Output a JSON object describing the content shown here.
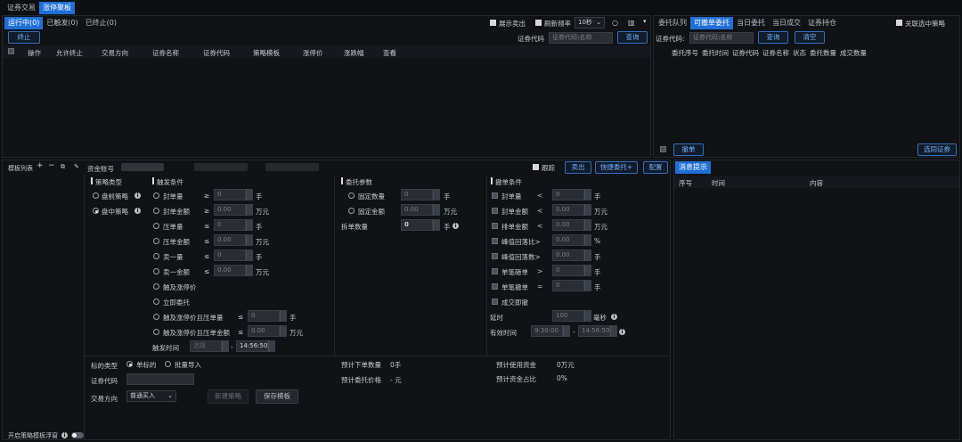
{
  "top_tabs": [
    "证券交易",
    "涨停聚板"
  ],
  "strategy_panel": {
    "status_tabs": [
      "运行中(0)",
      "已触发(0)",
      "已终止(0)"
    ],
    "show_sell": "展示卖出",
    "refresh_rate_label": "刷新频率",
    "refresh_rate_value": "10秒",
    "stop_button": "终止",
    "code_label": "证券代码",
    "code_placeholder": "证券代码\\名称",
    "query_button": "查询",
    "columns": [
      "操作",
      "允许终止",
      "交易方向",
      "证券名称",
      "证券代码",
      "策略模板",
      "涨停价",
      "涨跌幅",
      "查看"
    ]
  },
  "order_panel": {
    "tabs": [
      "委托队列",
      "可撤单委托",
      "当日委托",
      "当日成交",
      "证券持仓"
    ],
    "link_strategy": "关联选中策略",
    "code_label": "证券代码:",
    "code_placeholder": "证券代码\\名称",
    "query_button": "查询",
    "clear_button": "清空",
    "columns": [
      "委托序号",
      "委托时间",
      "证券代码",
      "证券名称",
      "状态",
      "委托数量",
      "成交数量"
    ],
    "cancel_button": "撤单",
    "select_all_button": "选同证券"
  },
  "template_toolbar": {
    "template_list": "模板列表",
    "account_label": "资金账号",
    "follow_label": "跟踪",
    "sell_button": "卖出",
    "quick_order_button": "快捷委托+",
    "config_button": "配置"
  },
  "strategy_type": {
    "title": "策略类型",
    "options": [
      "盘前策略",
      "盘中策略"
    ],
    "selected": 1
  },
  "trigger": {
    "title": "触发条件",
    "rows": [
      {
        "label": "封单量",
        "op": "≥",
        "value": "0",
        "unit": "手"
      },
      {
        "label": "封单金额",
        "op": "≥",
        "value": "0.00",
        "unit": "万元"
      },
      {
        "label": "压单量",
        "op": "≤",
        "value": "0",
        "unit": "手"
      },
      {
        "label": "压单金额",
        "op": "≤",
        "value": "0.00",
        "unit": "万元"
      },
      {
        "label": "卖一量",
        "op": "≤",
        "value": "0",
        "unit": "手"
      },
      {
        "label": "卖一金额",
        "op": "≤",
        "value": "0.00",
        "unit": "万元"
      }
    ],
    "option_touch": "触及涨停价",
    "option_immediate": "立即委托",
    "row_touch_vol": {
      "label": "触及涨停价且压单量",
      "op": "≤",
      "value": "0",
      "unit": "手"
    },
    "row_touch_amt": {
      "label": "触及涨停价且压单金额",
      "op": "≤",
      "value": "0.00",
      "unit": "万元"
    },
    "time_label": "触发时间",
    "time_start": "选择",
    "time_end": "14:56:50"
  },
  "order_params": {
    "title": "委托参数",
    "fixed_qty": "固定数量",
    "fixed_qty_value": "0",
    "fixed_qty_unit": "手",
    "fixed_amt": "固定金额",
    "fixed_amt_value": "0.00",
    "fixed_amt_unit": "万元",
    "split_label": "拆单数量",
    "split_value": "0",
    "split_unit": "手"
  },
  "cancel_cond": {
    "title": "撤单条件",
    "rows": [
      {
        "label": "封单量",
        "op": "<",
        "value": "0",
        "unit": "手"
      },
      {
        "label": "封单金额",
        "op": "<",
        "value": "0.00",
        "unit": "万元"
      },
      {
        "label": "排单金额",
        "op": "<",
        "value": "0.00",
        "unit": "万元"
      },
      {
        "label": "峰值回落比>",
        "op": "",
        "value": "0.00",
        "unit": "%"
      },
      {
        "label": "峰值回落数>",
        "op": "",
        "value": "0.00",
        "unit": "手"
      },
      {
        "label": "单笔砸单",
        "op": ">",
        "value": "0",
        "unit": "手"
      },
      {
        "label": "单笔撤单",
        "op": "=",
        "value": "0",
        "unit": "手"
      }
    ],
    "deal_cancel": "成交即撤",
    "delay_label": "延时",
    "delay_value": "100",
    "delay_unit": "毫秒",
    "valid_label": "有效时间",
    "valid_start": "9:30:00",
    "valid_end": "14:56:50"
  },
  "bottom": {
    "target_type": "标的类型",
    "single": "单标的",
    "batch": "批量导入",
    "code_label": "证券代码",
    "direction_label": "交易方向",
    "direction_value": "普通买入",
    "new_button": "新建策略",
    "save_button": "保存模板",
    "est_qty_label": "预计下单数量",
    "est_qty_value": "0手",
    "est_price_label": "预计委托价格",
    "est_price_value": "- 元",
    "est_funds_label": "预计使用资金",
    "est_funds_value": "0万元",
    "est_ratio_label": "预计资金占比",
    "est_ratio_value": "0%",
    "float_toggle": "开启策略模板浮窗"
  },
  "message_panel": {
    "tab": "消息提示",
    "columns": [
      "序号",
      "时间",
      "内容"
    ]
  },
  "colors": {
    "accent": "#1f6fd6",
    "bg": "#0d0f13",
    "panel": "#101216"
  }
}
